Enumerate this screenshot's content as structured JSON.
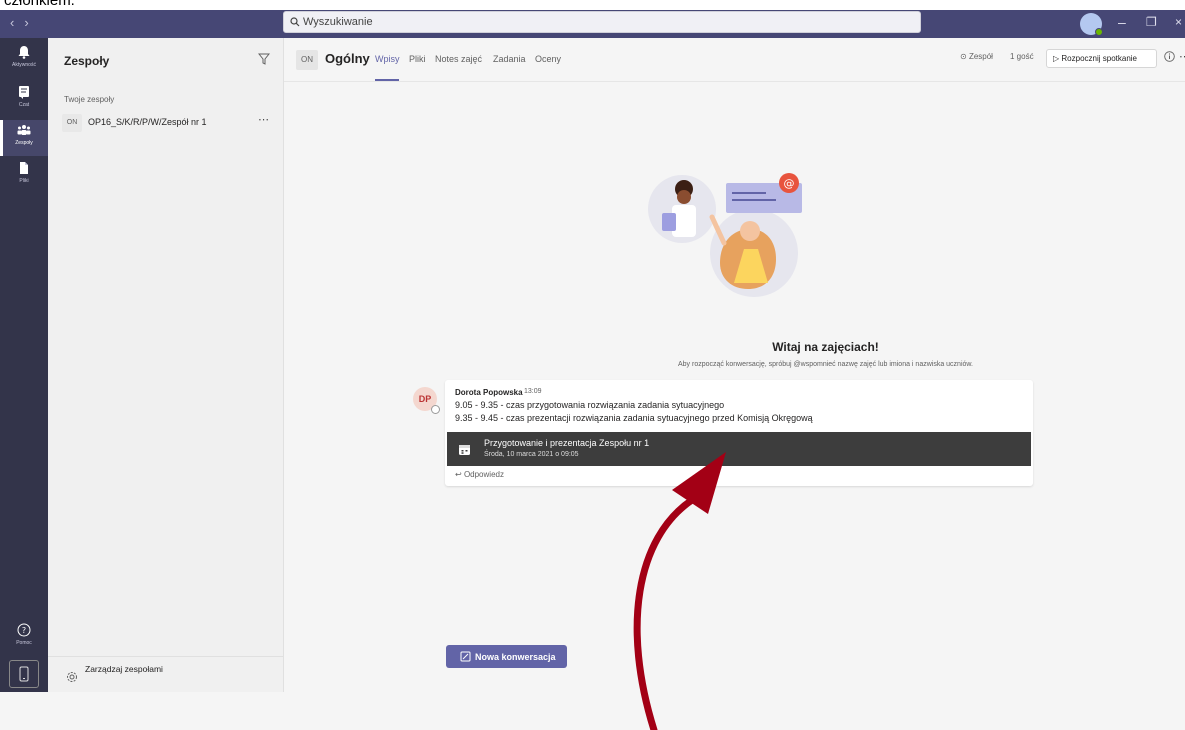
{
  "fragment_text": "członkiem.",
  "search": {
    "placeholder": "Wyszukiwanie"
  },
  "rail": {
    "activity": "Aktywność",
    "chat": "Czat",
    "teams": "Zespoły",
    "files": "Pliki",
    "help": "Pomoc"
  },
  "teams_panel": {
    "title": "Zespoły",
    "section": "Twoje zespoły",
    "team_tag": "ON",
    "team_name": "OP16_S/K/R/P/W/Zespół nr 1",
    "manage": "Zarządzaj zespołami"
  },
  "channel": {
    "tag": "ON",
    "title": "Ogólny",
    "tabs": [
      "Wpisy",
      "Pliki",
      "Notes zajęć",
      "Zadania",
      "Oceny"
    ],
    "team_label": "Zespół",
    "guests": "1 gość",
    "meet_button": "Rozpocznij spotkanie"
  },
  "welcome": {
    "title": "Witaj na zajęciach!",
    "subtitle": "Aby rozpocząć konwersację, spróbuj @wspomnieć nazwę zajęć lub imiona i nazwiska uczniów."
  },
  "post": {
    "avatar": "DP",
    "author": "Dorota Popowska",
    "time": "13:09",
    "lines": [
      "9.05 - 9.35 - czas przygotowania rozwiązania zadania sytuacyjnego",
      "9.35 - 9.45 - czas prezentacji rozwiązania zadania sytuacyjnego przed Komisją Okręgową"
    ],
    "meeting_title": "Przygotowanie i prezentacja Zespołu nr 1",
    "meeting_date": "Środa, 10 marca 2021 o 09:05",
    "reply": "Odpowiedz"
  },
  "new_conversation": "Nowa konwersacja",
  "colors": {
    "brand": "#464775",
    "accent": "#6264a7",
    "rail": "#33344a",
    "annotation_arrow": "#a30015"
  }
}
